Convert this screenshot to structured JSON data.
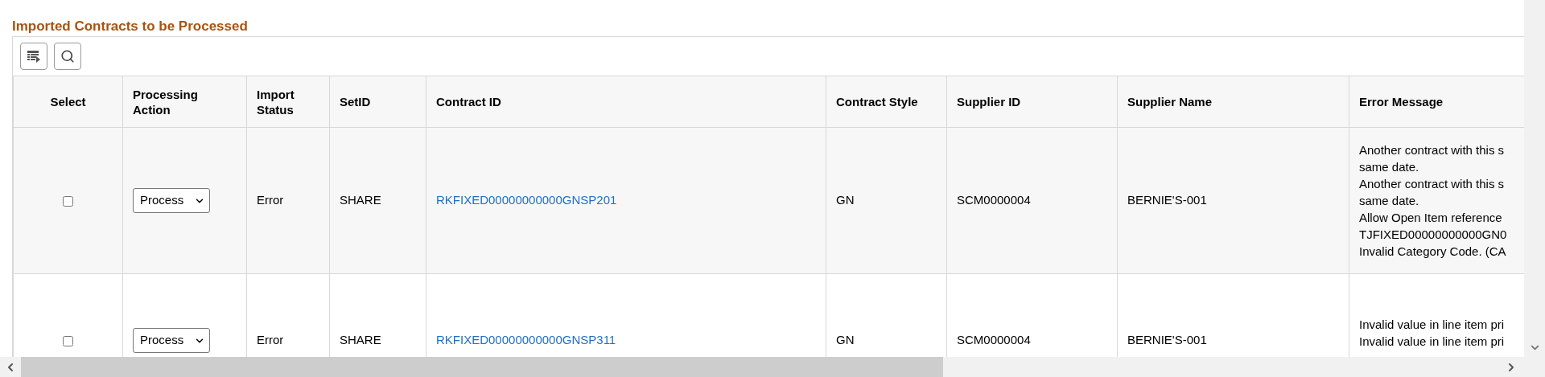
{
  "section_title": "Imported Contracts to be Processed",
  "table": {
    "columns": [
      "Select",
      "Processing Action",
      "Import Status",
      "SetID",
      "Contract ID",
      "Contract Style",
      "Supplier ID",
      "Supplier Name",
      "Error Message"
    ],
    "rows": [
      {
        "selected": false,
        "processing_action": "Process",
        "import_status": "Error",
        "setid": "SHARE",
        "contract_id": "RKFIXED00000000000GNSP201",
        "contract_style": "GN",
        "supplier_id": "SCM0000004",
        "supplier_name": "BERNIE'S-001",
        "error_message": [
          "Another contract with this s",
          "same date.",
          "Another contract with this s",
          "same date.",
          "Allow Open Item reference",
          "TJFIXED00000000000GN0",
          "Invalid Category Code. (CA"
        ]
      },
      {
        "selected": false,
        "processing_action": "Process",
        "import_status": "Error",
        "setid": "SHARE",
        "contract_id": "RKFIXED00000000000GNSP311",
        "contract_style": "GN",
        "supplier_id": "SCM0000004",
        "supplier_name": "BERNIE'S-001",
        "error_message": [
          "Invalid value in line item pri",
          "Invalid value in line item pri"
        ]
      }
    ]
  }
}
